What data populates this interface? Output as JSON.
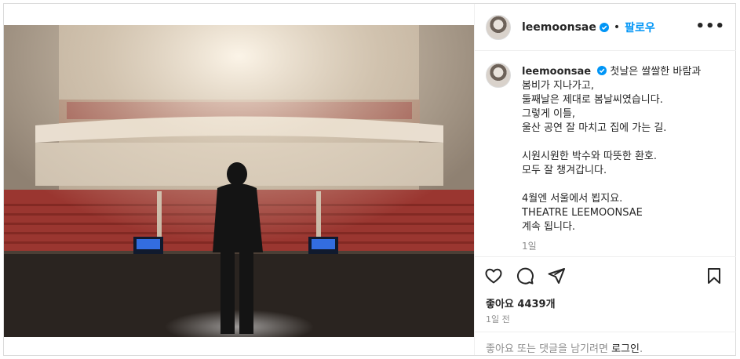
{
  "post": {
    "username": "leemoonsae",
    "follow_label": "팔로우",
    "separator": "•",
    "more_label": "•••",
    "caption_lines": "첫날은 쌀쌀한 바람과\n봄비가 지나가고,\n둘째날은 제대로 봄날씨였습니다.\n그렇게 이틀,\n울산 공연 잘 마치고 집에 가는 길.\n\n시원시원한 박수와 따뜻한 환호.\n모두 잘 챙겨갑니다.\n\n4월엔 서울에서 뵙지요.\nTHEATRE LEEMOONSAE\n계속 됩니다.",
    "caption_time": "1일",
    "likes_label": "좋아요 4439개",
    "post_date": "1일 전",
    "comment_prompt": "좋아요 또는 댓글을 남기려면 ",
    "login_label": "로그인",
    "comment_suffix": "."
  },
  "icons": {
    "verified": "verified-badge-icon",
    "like": "heart-icon",
    "comment": "comment-icon",
    "share": "paper-plane-icon",
    "save": "bookmark-icon"
  },
  "colors": {
    "accent": "#0095f6",
    "text": "#262626",
    "muted": "#8e8e8e",
    "border": "#dbdbdb"
  }
}
